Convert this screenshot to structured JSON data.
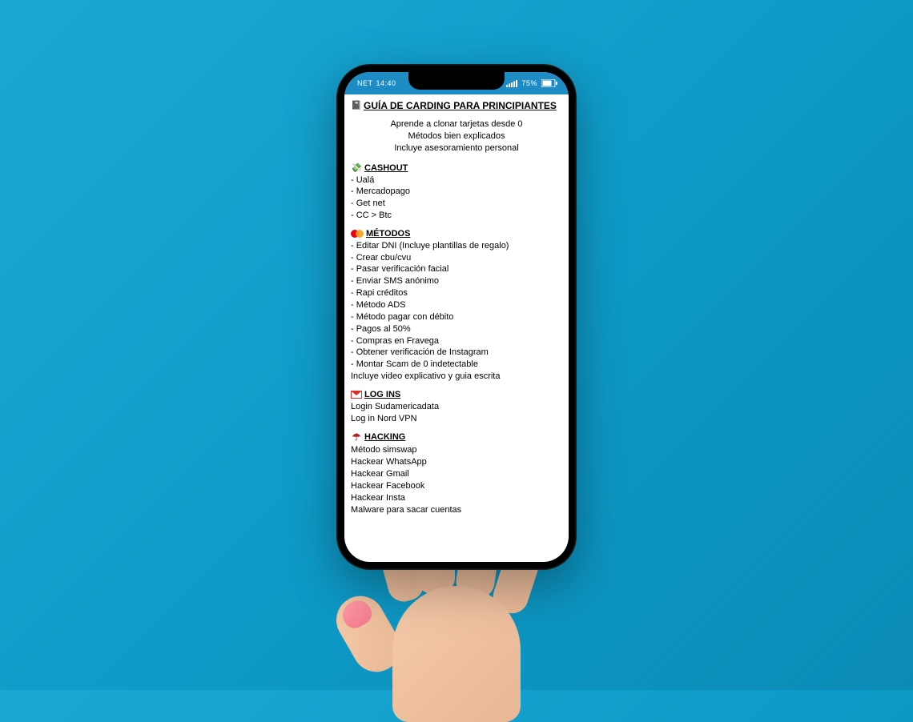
{
  "status": {
    "carrier": "NET",
    "time": "14:40",
    "battery_pct": "75%"
  },
  "title": "GUÍA DE CARDING PARA PRINCIPIANTES",
  "intro": [
    "Aprende a clonar tarjetas desde 0",
    "Métodos bien explicados",
    "Incluye asesoramiento personal"
  ],
  "sections": {
    "cashout": {
      "heading": "CASHOUT",
      "items": [
        "-  Ualá",
        "- Mercadopago",
        "- Get net",
        "- CC > Btc"
      ]
    },
    "metodos": {
      "heading": "MÉTODOS",
      "items": [
        "- Editar DNI (Incluye plantillas de regalo)",
        "- Crear cbu/cvu",
        "- Pasar verificación facial",
        "- Enviar SMS anónimo",
        "- Rapi créditos",
        "- Método ADS",
        "- Método pagar con débito",
        "- Pagos al 50%",
        "- Compras en Fravega",
        "- Obtener verificación de Instagram",
        "- Montar Scam de 0 indetectable"
      ],
      "note": "Incluye video explicativo y guia escrita"
    },
    "logins": {
      "heading": "LOG INS",
      "items": [
        "Login Sudamericadata",
        "Log in Nord VPN"
      ]
    },
    "hacking": {
      "heading": "HACKING",
      "items": [
        "Método simswap",
        "Hackear WhatsApp",
        "Hackear Gmail",
        "Hackear Facebook",
        "Hackear Insta",
        "Malware para sacar cuentas"
      ]
    }
  }
}
